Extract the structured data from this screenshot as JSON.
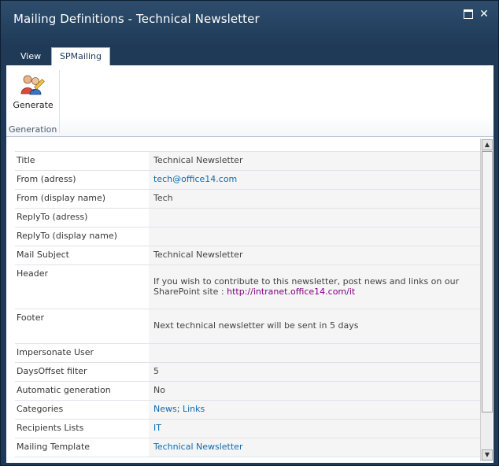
{
  "window": {
    "title": "Mailing Definitions - Technical Newsletter",
    "maximize_icon": "maximize-icon",
    "close_icon": "close-icon",
    "close_glyph": "✕"
  },
  "tabs": [
    {
      "label": "View",
      "active": false
    },
    {
      "label": "SPMailing",
      "active": true
    }
  ],
  "ribbon": {
    "button_label": "Generate",
    "button_icon": "users-edit-icon",
    "group_label": "Generation"
  },
  "fields": [
    {
      "label": "Title",
      "value": "Technical Newsletter"
    },
    {
      "label": "From (adress)",
      "value": "tech@office14.com"
    },
    {
      "label": "From (display name)",
      "value": "Tech"
    },
    {
      "label": "ReplyTo (adress)",
      "value": ""
    },
    {
      "label": "ReplyTo (display name)",
      "value": ""
    },
    {
      "label": "Mail Subject",
      "value": "Technical Newsletter"
    },
    {
      "label": "Header",
      "value": "If you wish to contribute to this newsletter, post news and links on our SharePoint site : ",
      "link": "http://intranet.office14.com/it"
    },
    {
      "label": "Footer",
      "value": "Next technical newsletter will be sent in 5 days"
    },
    {
      "label": "Impersonate User",
      "value": ""
    },
    {
      "label": "DaysOffset filter",
      "value": "5"
    },
    {
      "label": "Automatic generation",
      "value": "No"
    },
    {
      "label": "Categories",
      "link1": "News",
      "separator": "; ",
      "link2": "Links"
    },
    {
      "label": "Recipients Lists",
      "value": "IT"
    },
    {
      "label": "Mailing Template",
      "value": "Technical Newsletter"
    }
  ],
  "colors": {
    "link": "#0f6aad",
    "visited_link": "#800080",
    "title_bar": "#1e3a57"
  }
}
